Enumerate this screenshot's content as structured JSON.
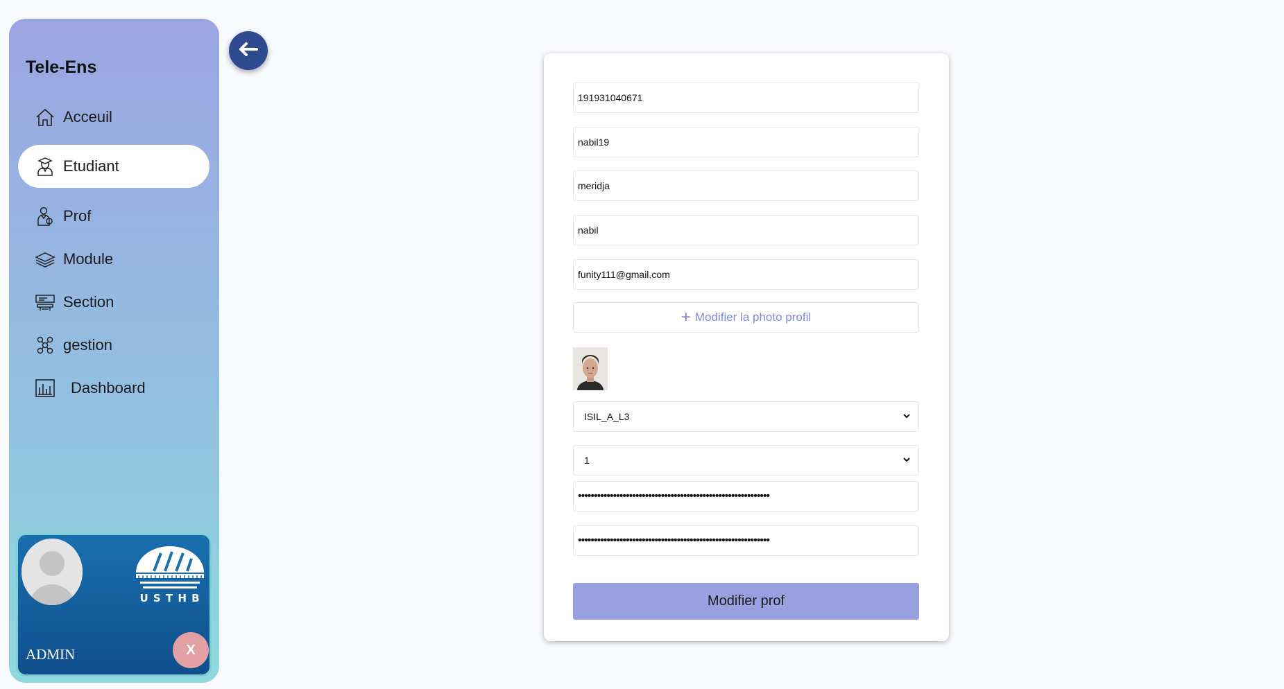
{
  "sidebar": {
    "brand": "Tele-Ens",
    "items": [
      {
        "label": "Acceuil",
        "icon": "home-icon"
      },
      {
        "label": "Etudiant",
        "icon": "student-icon",
        "active": true
      },
      {
        "label": "Prof",
        "icon": "teacher-icon"
      },
      {
        "label": "Module",
        "icon": "layers-icon"
      },
      {
        "label": "Section",
        "icon": "classroom-icon"
      },
      {
        "label": "gestion",
        "icon": "network-icon"
      },
      {
        "label": "Dashboard",
        "icon": "chart-icon"
      }
    ],
    "profile": {
      "role": "ADMIN",
      "close_label": "X",
      "logo_text": "U S T H B"
    }
  },
  "form": {
    "matricule": "191931040671",
    "username": "nabil19",
    "nom": "meridja",
    "prenom": "nabil",
    "email": "funity111@gmail.com",
    "upload_label": "Modifier la photo profil",
    "section_select": "ISIL_A_L3",
    "group_select": "1",
    "password": "••••••••••••••••••••••••••••••••••••••••••••••••••••••••••••",
    "password_confirm": "••••••••••••••••••••••••••••••••••••••••••••••••••••••••••••",
    "submit_label": "Modifier prof"
  },
  "colors": {
    "sidebar_top": "#9ba5e3",
    "sidebar_bottom": "#8fd9dd",
    "accent": "#98a0e0",
    "back_button": "#2e4a91",
    "profile_card": "#1a6fae",
    "close_button": "#e2a0a4"
  }
}
